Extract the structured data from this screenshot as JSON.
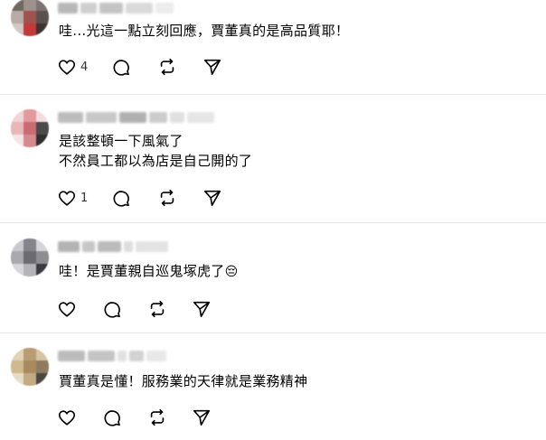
{
  "replies": [
    {
      "text": "哇...光這一點立刻回應，賈董真的是高品質耶！",
      "like_count": "4",
      "emoji": ""
    },
    {
      "text": "是該整頓一下風氣了\n不然員工都以為店是自己開的了",
      "like_count": "1",
      "emoji": ""
    },
    {
      "text": "哇！是賈董親自巡鬼塚虎了",
      "like_count": "",
      "emoji": "😔"
    },
    {
      "text": "賈董真是懂！服務業的天律就是業務精神",
      "like_count": "",
      "emoji": ""
    }
  ],
  "icons": {
    "like": "heart-icon",
    "comment": "comment-icon",
    "repost": "repost-icon",
    "share": "send-icon"
  },
  "colors": {
    "text": "#000000",
    "icon": "#000000",
    "divider": "#e5e5e5",
    "count": "#333333"
  }
}
